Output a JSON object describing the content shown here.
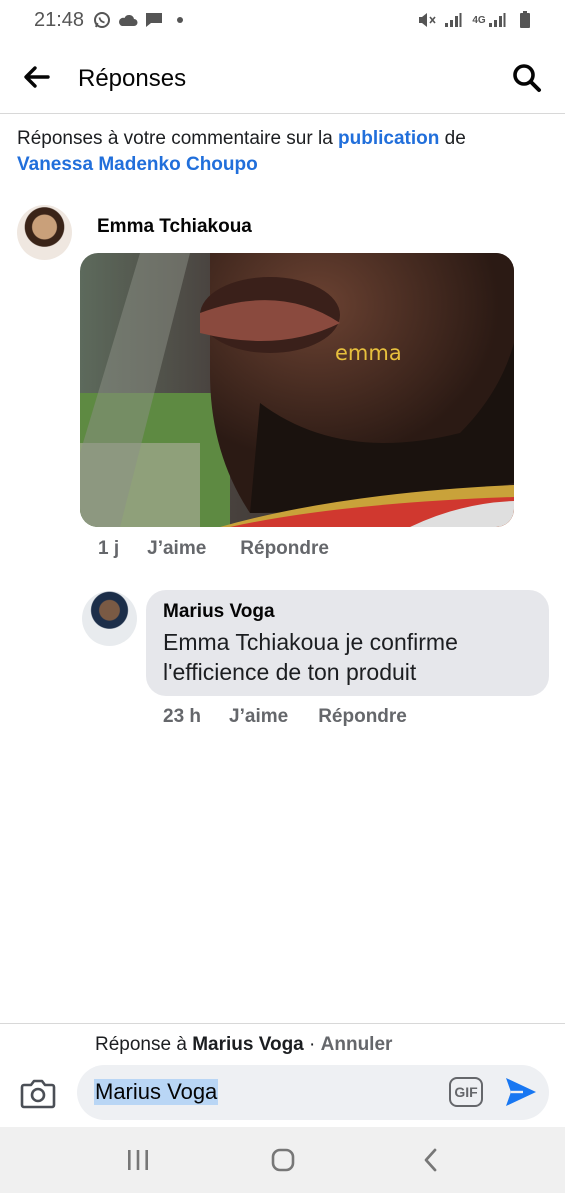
{
  "status_bar": {
    "time": "21:48",
    "left_icons": [
      "whatsapp-icon",
      "cloud-icon",
      "chat-bubble-icon",
      "dot-icon"
    ],
    "right_icons": [
      "mute-icon",
      "signal-icon",
      "4g-signal-icon",
      "battery-icon"
    ],
    "network_label": "4G"
  },
  "header": {
    "title": "Réponses"
  },
  "context": {
    "prefix": "Réponses à votre commentaire sur la ",
    "link_text": "publication",
    "middle": " de ",
    "author_link": "Vanessa Madenko Choupo"
  },
  "comment": {
    "author": "Emma Tchiakoua",
    "photo_caption": "emma",
    "time": "1 j",
    "like_label": "J’aime",
    "reply_label": "Répondre"
  },
  "reply": {
    "author": "Marius Voga",
    "text": "Emma Tchiakoua je confirme l'efficience de ton produit",
    "time": "23 h",
    "like_label": "J’aime",
    "reply_label": "Répondre"
  },
  "composer": {
    "replying_prefix": "Réponse à ",
    "replying_name": "Marius Voga",
    "separator": " · ",
    "cancel_label": "Annuler",
    "input_value": "Marius Voga",
    "gif_label": "GIF"
  },
  "colors": {
    "link_blue": "#216fdb",
    "muted_gray": "#65676b",
    "bubble_gray": "#e6e7eb",
    "send_blue": "#1877f2"
  }
}
